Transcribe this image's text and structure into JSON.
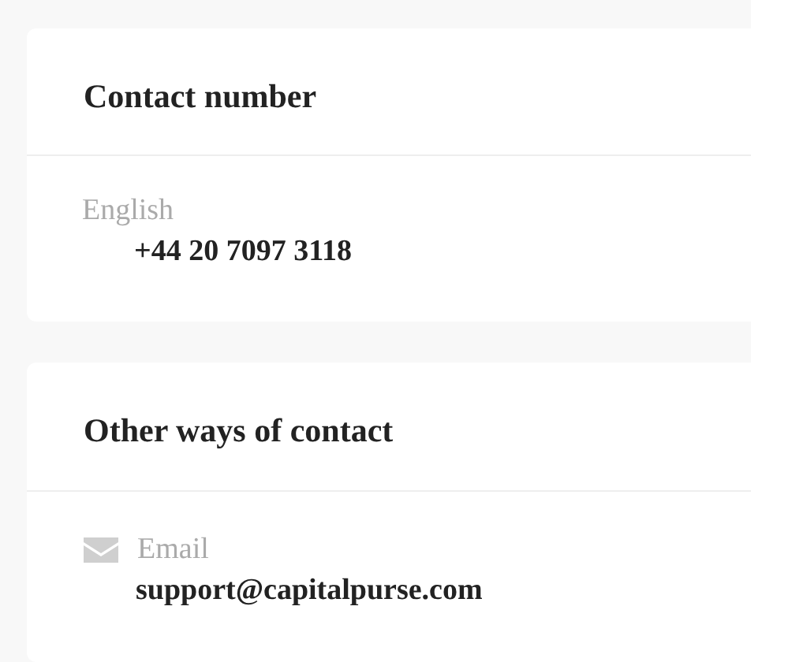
{
  "contact_number": {
    "title": "Contact number",
    "entries": [
      {
        "label": "English",
        "value": "+44 20 7097 3118"
      }
    ]
  },
  "other_contact": {
    "title": "Other ways of contact",
    "entries": [
      {
        "kind": "email",
        "label": "Email",
        "value": "support@capitalpurse.com"
      }
    ]
  }
}
